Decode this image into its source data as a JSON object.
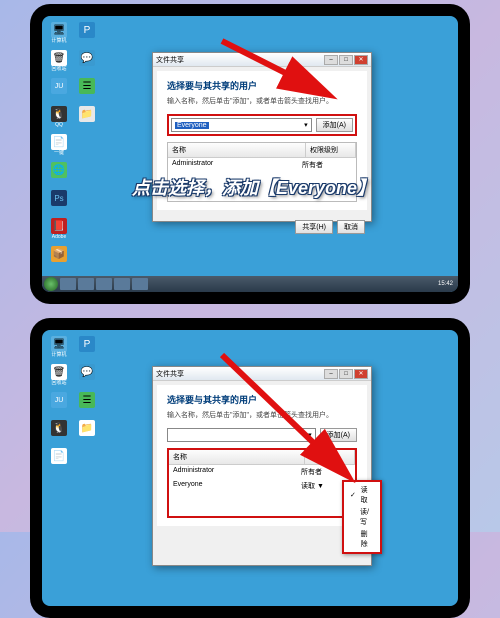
{
  "overlay": {
    "text1": "点击选择，添加【Everyone】"
  },
  "desktop": {
    "icons": [
      "计算机",
      "回收站",
      "网络",
      "控制面板",
      "QQ",
      "微信",
      "浏览器",
      "Photoshop",
      "Adobe",
      "一键"
    ]
  },
  "dialog1": {
    "title": "文件共享",
    "heading": "选择要与其共享的用户",
    "sub": "输入名称，然后单击\"添加\"，或者单击箭头查找用户。",
    "combo_value": "Everyone",
    "add_btn": "添加(A)",
    "col_name": "名称",
    "col_perm": "权限级别",
    "rows": [
      {
        "name": "Administrator",
        "perm": "所有者"
      }
    ],
    "footer_share": "共享(H)",
    "footer_cancel": "取消"
  },
  "dialog2": {
    "title": "文件共享",
    "heading": "选择要与其共享的用户",
    "sub": "输入名称，然后单击\"添加\"，或者单击箭头查找用户。",
    "add_btn": "添加(A)",
    "col_name": "名称",
    "col_perm": "权限级别",
    "rows": [
      {
        "name": "Administrator",
        "perm": "所有者"
      },
      {
        "name": "Everyone",
        "perm": "读取 ▼"
      }
    ],
    "perm_menu": [
      "读取",
      "读/写",
      "删除"
    ]
  },
  "taskbar": {
    "time": "15:42"
  },
  "colors": {
    "arrow": "#e01010"
  }
}
